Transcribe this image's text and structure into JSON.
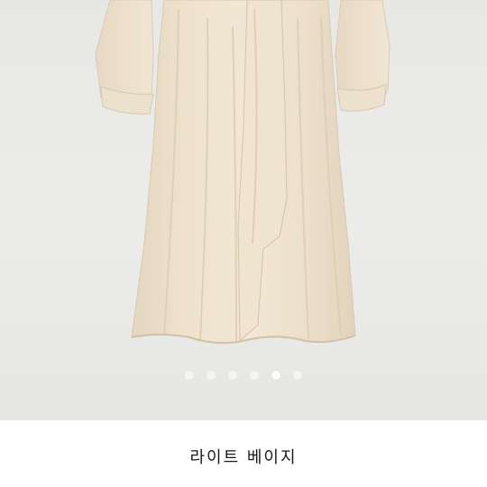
{
  "product_image": {
    "icon": "dress-image",
    "dress_color": "#eee3cf"
  },
  "pagination": {
    "total": 6,
    "active_index": 4
  },
  "caption": {
    "text": "라이트 베이지"
  }
}
